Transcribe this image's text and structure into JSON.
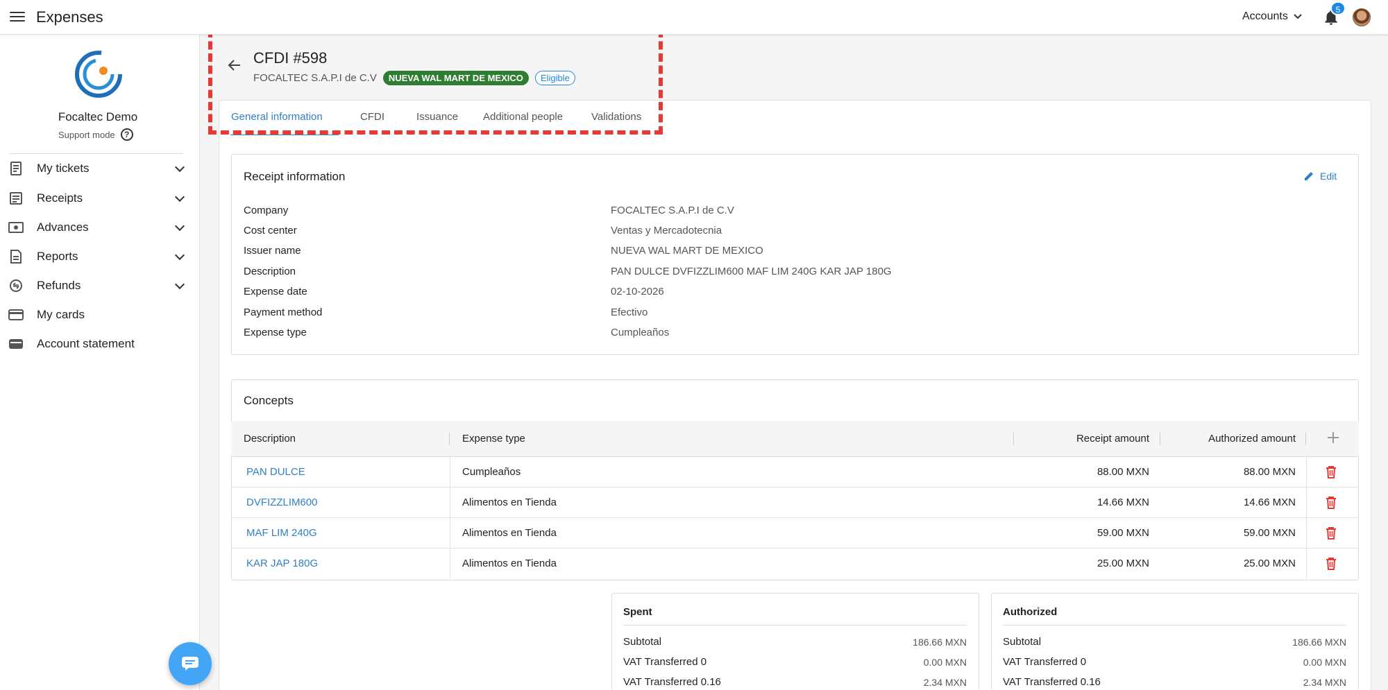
{
  "app": {
    "title": "Expenses"
  },
  "topbar": {
    "accounts_label": "Accounts",
    "notifications_count": "5"
  },
  "sidebar": {
    "org_name": "Focaltec Demo",
    "support_mode": "Support mode",
    "items": [
      {
        "label": "My tickets",
        "icon": "ticket-icon",
        "expandable": true
      },
      {
        "label": "Receipts",
        "icon": "receipt-icon",
        "expandable": true
      },
      {
        "label": "Advances",
        "icon": "cash-icon",
        "expandable": true
      },
      {
        "label": "Reports",
        "icon": "report-icon",
        "expandable": true
      },
      {
        "label": "Refunds",
        "icon": "refund-icon",
        "expandable": true
      },
      {
        "label": "My cards",
        "icon": "card-icon",
        "expandable": false
      },
      {
        "label": "Account statement",
        "icon": "wallet-icon",
        "expandable": false
      }
    ]
  },
  "header": {
    "title": "CFDI #598",
    "company": "FOCALTEC S.A.P.I de C.V",
    "issuer_chip": "NUEVA WAL MART DE MEXICO",
    "status_chip": "Eligible"
  },
  "tabs": [
    {
      "label": "General information",
      "active": true
    },
    {
      "label": "CFDI",
      "active": false
    },
    {
      "label": "Issuance",
      "active": false
    },
    {
      "label": "Additional people",
      "active": false
    },
    {
      "label": "Validations",
      "active": false
    }
  ],
  "receipt_info": {
    "title": "Receipt information",
    "edit_label": "Edit",
    "fields": [
      {
        "label": "Company",
        "value": "FOCALTEC S.A.P.I de C.V"
      },
      {
        "label": "Cost center",
        "value": "Ventas y Mercadotecnia"
      },
      {
        "label": "Issuer name",
        "value": "NUEVA WAL MART DE MEXICO"
      },
      {
        "label": "Description",
        "value": "PAN DULCE DVFIZZLIM600 MAF LIM 240G KAR JAP 180G"
      },
      {
        "label": "Expense date",
        "value": "02-10-2026"
      },
      {
        "label": "Payment method",
        "value": "Efectivo"
      },
      {
        "label": "Expense type",
        "value": "Cumpleaños"
      }
    ]
  },
  "concepts": {
    "title": "Concepts",
    "columns": [
      "Description",
      "Expense type",
      "Receipt amount",
      "Authorized amount"
    ],
    "rows": [
      {
        "description": "PAN DULCE",
        "expense_type": "Cumpleaños",
        "receipt_amount": "88.00 MXN",
        "authorized_amount": "88.00 MXN"
      },
      {
        "description": "DVFIZZLIM600",
        "expense_type": "Alimentos en Tienda",
        "receipt_amount": "14.66 MXN",
        "authorized_amount": "14.66 MXN"
      },
      {
        "description": "MAF LIM 240G",
        "expense_type": "Alimentos en Tienda",
        "receipt_amount": "59.00 MXN",
        "authorized_amount": "59.00 MXN"
      },
      {
        "description": "KAR JAP 180G",
        "expense_type": "Alimentos en Tienda",
        "receipt_amount": "25.00 MXN",
        "authorized_amount": "25.00 MXN"
      }
    ]
  },
  "summary": {
    "spent": {
      "title": "Spent",
      "lines": [
        {
          "label": "Subtotal",
          "value": "186.66 MXN"
        },
        {
          "label": "VAT Transferred 0",
          "value": "0.00 MXN"
        },
        {
          "label": "VAT Transferred 0.16",
          "value": "2.34 MXN"
        }
      ]
    },
    "authorized": {
      "title": "Authorized",
      "lines": [
        {
          "label": "Subtotal",
          "value": "186.66 MXN"
        },
        {
          "label": "VAT Transferred 0",
          "value": "0.00 MXN"
        },
        {
          "label": "VAT Transferred 0.16",
          "value": "2.34 MXN"
        }
      ]
    }
  },
  "colors": {
    "accent": "#2f80c8",
    "success": "#2e7d32",
    "danger": "#e53935",
    "highlight": "#e53935"
  }
}
